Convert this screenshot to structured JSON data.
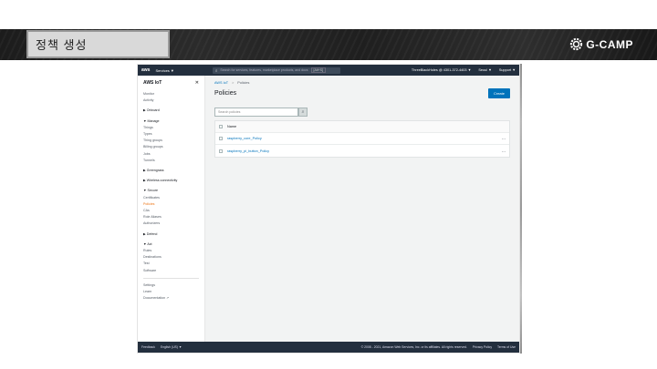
{
  "slide": {
    "title": "정책 생성",
    "brand": "G-CAMP"
  },
  "console": {
    "topbar": {
      "logo": "aws",
      "services": "Services ▼",
      "search_placeholder": "Search for services, features, marketplace products, and docs",
      "search_shortcut": "[Alt+S]",
      "account": "ThreeBlackHoles @ 4301-372-4403 ▼",
      "region": "Seoul ▼",
      "support": "Support ▼"
    },
    "sidebar": {
      "title": "AWS IoT",
      "close": "✕",
      "items": [
        {
          "label": "Monitor",
          "type": "item"
        },
        {
          "label": "Activity",
          "type": "item"
        },
        {
          "label": "▶ Onboard",
          "type": "grp"
        },
        {
          "label": "▼ Manage",
          "type": "grp"
        },
        {
          "label": "Things",
          "type": "sub"
        },
        {
          "label": "Types",
          "type": "sub"
        },
        {
          "label": "Thing groups",
          "type": "sub"
        },
        {
          "label": "Billing groups",
          "type": "sub"
        },
        {
          "label": "Jobs",
          "type": "sub"
        },
        {
          "label": "Tunnels",
          "type": "sub"
        },
        {
          "label": "▶ Greengrass",
          "type": "grp"
        },
        {
          "label": "▶ Wireless connectivity",
          "type": "grp"
        },
        {
          "label": "▼ Secure",
          "type": "grp"
        },
        {
          "label": "Certificates",
          "type": "sub"
        },
        {
          "label": "Policies",
          "type": "active"
        },
        {
          "label": "CAs",
          "type": "sub"
        },
        {
          "label": "Role Aliases",
          "type": "sub"
        },
        {
          "label": "Authorizers",
          "type": "sub"
        },
        {
          "label": "▶ Defend",
          "type": "grp"
        },
        {
          "label": "▼ Act",
          "type": "grp"
        },
        {
          "label": "Rules",
          "type": "sub"
        },
        {
          "label": "Destinations",
          "type": "sub"
        },
        {
          "label": "Test",
          "type": "item"
        },
        {
          "label": "Software",
          "type": "item"
        },
        {
          "label": "Settings",
          "type": "item"
        },
        {
          "label": "Learn",
          "type": "item"
        },
        {
          "label": "Documentation ↗",
          "type": "item"
        }
      ]
    },
    "breadcrumb": {
      "root": "AWS IoT",
      "sep": ">",
      "current": "Policies"
    },
    "main": {
      "heading": "Policies",
      "create_label": "Create",
      "search_placeholder": "Search policies",
      "search_button": "🔍",
      "table_header": "Name",
      "rows": [
        {
          "name": "raspberry_core_Policy",
          "more": "..."
        },
        {
          "name": "raspberry_pi_button_Policy",
          "more": "..."
        }
      ]
    },
    "footer": {
      "feedback": "Feedback",
      "language": "English (US) ▼",
      "copyright": "© 2008 - 2021, Amazon Web Services, Inc. or its affiliates. All rights reserved.",
      "privacy": "Privacy Policy",
      "terms": "Terms of Use"
    }
  }
}
